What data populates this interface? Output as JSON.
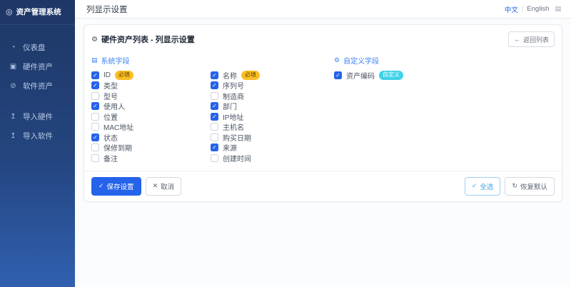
{
  "app": {
    "title": "资产管理系统",
    "logo_icon": "◎"
  },
  "sidebar": {
    "items": [
      {
        "name": "dashboard",
        "icon": "dashboard-icon",
        "glyph": "◔",
        "label": "仪表盘",
        "group": 1
      },
      {
        "name": "hardware-assets",
        "icon": "hardware-icon",
        "glyph": "▣",
        "label": "硬件资产",
        "group": 1
      },
      {
        "name": "software-assets",
        "icon": "software-icon",
        "glyph": "⊘",
        "label": "软件资产",
        "group": 1
      },
      {
        "name": "import-hardware",
        "icon": "import-hardware-icon",
        "glyph": "↥",
        "label": "导入硬件",
        "group": 2
      },
      {
        "name": "import-software",
        "icon": "import-software-icon",
        "glyph": "↥",
        "label": "导入软件",
        "group": 2
      }
    ]
  },
  "header": {
    "title": "列显示设置",
    "lang_zh": "中文",
    "lang_sep": "|",
    "lang_en": "English",
    "extra_icon": "▤"
  },
  "card": {
    "title_icon": "⚙",
    "title": "硬件资产列表 - 列显示设置",
    "back_icon": "←",
    "back_label": "返回列表",
    "system_section_icon": "▤",
    "system_section": "系统字段",
    "custom_section_icon": "⚙",
    "custom_section": "自定义字段",
    "columns": [
      [
        {
          "label": "ID",
          "checked": true,
          "badge": "必填",
          "badge_type": "required"
        },
        {
          "label": "类型",
          "checked": true
        },
        {
          "label": "型号",
          "checked": false
        },
        {
          "label": "使用人",
          "checked": true
        },
        {
          "label": "位置",
          "checked": false
        },
        {
          "label": "MAC地址",
          "checked": false
        },
        {
          "label": "状态",
          "checked": true
        },
        {
          "label": "保修到期",
          "checked": false
        },
        {
          "label": "备注",
          "checked": false
        }
      ],
      [
        {
          "label": "名称",
          "checked": true,
          "badge": "必填",
          "badge_type": "required"
        },
        {
          "label": "序列号",
          "checked": true
        },
        {
          "label": "制造商",
          "checked": false
        },
        {
          "label": "部门",
          "checked": true
        },
        {
          "label": "IP地址",
          "checked": true
        },
        {
          "label": "主机名",
          "checked": false
        },
        {
          "label": "购买日期",
          "checked": false
        },
        {
          "label": "来源",
          "checked": true
        },
        {
          "label": "创建时间",
          "checked": false
        }
      ],
      [
        {
          "label": "资产编码",
          "checked": true,
          "badge": "自定义",
          "badge_type": "custom"
        }
      ]
    ],
    "footer": {
      "save_icon": "✓",
      "save_label": "保存设置",
      "cancel_icon": "✕",
      "cancel_label": "取消",
      "select_all_icon": "✓",
      "select_all_label": "全选",
      "restore_icon": "↻",
      "restore_label": "恢复默认"
    }
  },
  "colors": {
    "primary": "#2563eb",
    "sidebar_top": "#1d3765",
    "sidebar_bottom": "#3060b0",
    "section_title": "#3b82f6",
    "badge_required_bg": "#fbbf24",
    "badge_custom_bg": "#3fd2e8"
  }
}
